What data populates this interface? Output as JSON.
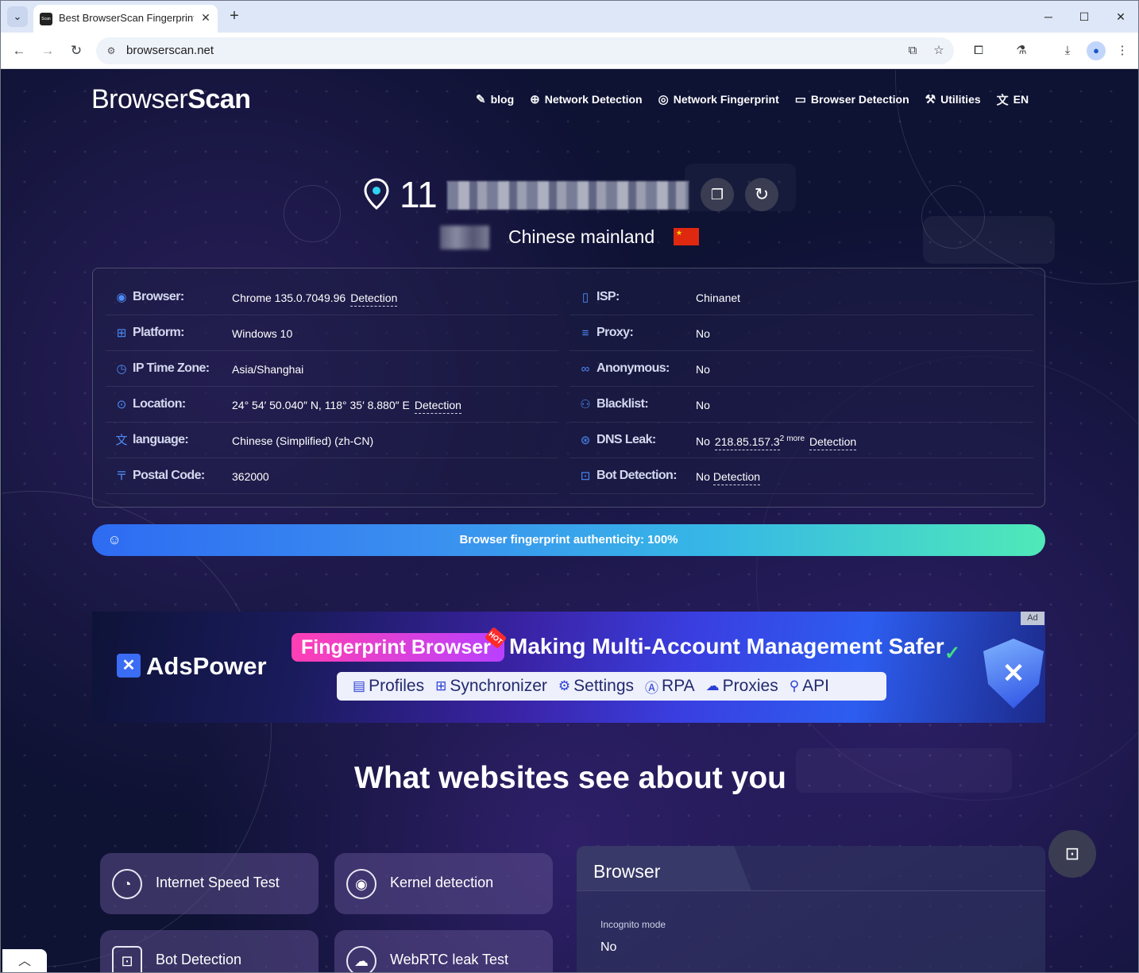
{
  "browser": {
    "tab_title": "Best BrowserScan Fingerprint",
    "tab_favicon_text": "Scan",
    "url": "browserscan.net",
    "controls": {
      "minimize": "─",
      "maximize": "☐",
      "close": "✕",
      "new_tab": "+",
      "tab_close": "✕",
      "tab_list": "⌄"
    },
    "nav_icons": {
      "back": "←",
      "forward": "→",
      "reload": "↻"
    },
    "toolbar_icons": {
      "translate": "⧉",
      "bookmark": "☆",
      "extensions": "⧠",
      "labs": "⚗",
      "download": "⤓",
      "menu": "⋮",
      "profile": "●"
    }
  },
  "site": {
    "logo_a": "Browser",
    "logo_b": "Scan",
    "nav": [
      {
        "label": "blog",
        "icon": "blog-icon",
        "glyph": "✎"
      },
      {
        "label": "Network Detection",
        "icon": "globe-icon",
        "glyph": "⊕"
      },
      {
        "label": "Network Fingerprint",
        "icon": "fingerprint-icon",
        "glyph": "◎"
      },
      {
        "label": "Browser Detection",
        "icon": "browser-icon",
        "glyph": "▭"
      },
      {
        "label": "Utilities",
        "icon": "wrench-icon",
        "glyph": "⚒"
      },
      {
        "label": "EN",
        "icon": "translate-icon",
        "glyph": "文"
      }
    ]
  },
  "ip": {
    "prefix": "11",
    "region": "Chinese mainland",
    "flag_glyph": "★",
    "copy_glyph": "❐",
    "refresh_glyph": "↻"
  },
  "info": {
    "left": [
      {
        "label": "Browser:",
        "icon": "chrome-icon",
        "glyph": "◉",
        "value": "Chrome 135.0.7049.96",
        "link": "Detection"
      },
      {
        "label": "Platform:",
        "icon": "windows-icon",
        "glyph": "⊞",
        "value": "Windows 10",
        "link": ""
      },
      {
        "label": "IP Time Zone:",
        "icon": "timezone-icon",
        "glyph": "◷",
        "value": "Asia/Shanghai",
        "link": ""
      },
      {
        "label": "Location:",
        "icon": "location-icon",
        "glyph": "⊙",
        "value": "24° 54′ 50.040″ N, 118° 35′ 8.880″ E",
        "link": "Detection"
      },
      {
        "label": "language:",
        "icon": "language-icon",
        "glyph": "文",
        "value": "Chinese (Simplified) (zh-CN)",
        "link": ""
      },
      {
        "label": "Postal Code:",
        "icon": "postal-icon",
        "glyph": "〒",
        "value": "362000",
        "link": ""
      }
    ],
    "right": [
      {
        "label": "ISP:",
        "icon": "isp-icon",
        "glyph": "▯",
        "value": "Chinanet",
        "link": ""
      },
      {
        "label": "Proxy:",
        "icon": "proxy-icon",
        "glyph": "≡",
        "value": "No",
        "link": ""
      },
      {
        "label": "Anonymous:",
        "icon": "mask-icon",
        "glyph": "∞",
        "value": "No",
        "link": ""
      },
      {
        "label": "Blacklist:",
        "icon": "user-icon",
        "glyph": "⚇",
        "value": "No",
        "link": ""
      },
      {
        "label": "DNS Leak:",
        "icon": "dns-icon",
        "glyph": "⊛",
        "value": "No",
        "dns_ip": "218.85.157.3",
        "more_count": "2",
        "more_label": "more",
        "link": "Detection"
      },
      {
        "label": "Bot Detection:",
        "icon": "bot-icon",
        "glyph": "⊡",
        "value": "No",
        "link": "Detection"
      }
    ]
  },
  "authenticity": {
    "text": "Browser fingerprint authenticity: 100%",
    "percent": 100,
    "glyph": "☺"
  },
  "ad": {
    "brand": "AdsPower",
    "pill": "Fingerprint Browser",
    "hot": "HOT",
    "headline": "Making Multi-Account Management Safer",
    "tag": "Ad",
    "features": [
      {
        "label": "Profiles",
        "glyph": "▤"
      },
      {
        "label": "Synchronizer",
        "glyph": "⊞"
      },
      {
        "label": "Settings",
        "glyph": "⚙"
      },
      {
        "label": "RPA",
        "glyph": "Ⓐ"
      },
      {
        "label": "Proxies",
        "glyph": "☁"
      },
      {
        "label": "API",
        "glyph": "⚲"
      }
    ]
  },
  "section_title": "What websites see about you",
  "cards": [
    {
      "label": "Internet Speed Test",
      "glyph": "◔"
    },
    {
      "label": "Kernel detection",
      "glyph": "◉"
    },
    {
      "label": "Bot Detection",
      "glyph": "⊡"
    },
    {
      "label": "WebRTC leak Test",
      "glyph": "☁"
    }
  ],
  "browser_panel": {
    "title": "Browser",
    "incognito_label": "Incognito mode",
    "incognito_value": "No"
  },
  "floating": {
    "bot_glyph": "⊡",
    "scroll_glyph": "︿"
  }
}
